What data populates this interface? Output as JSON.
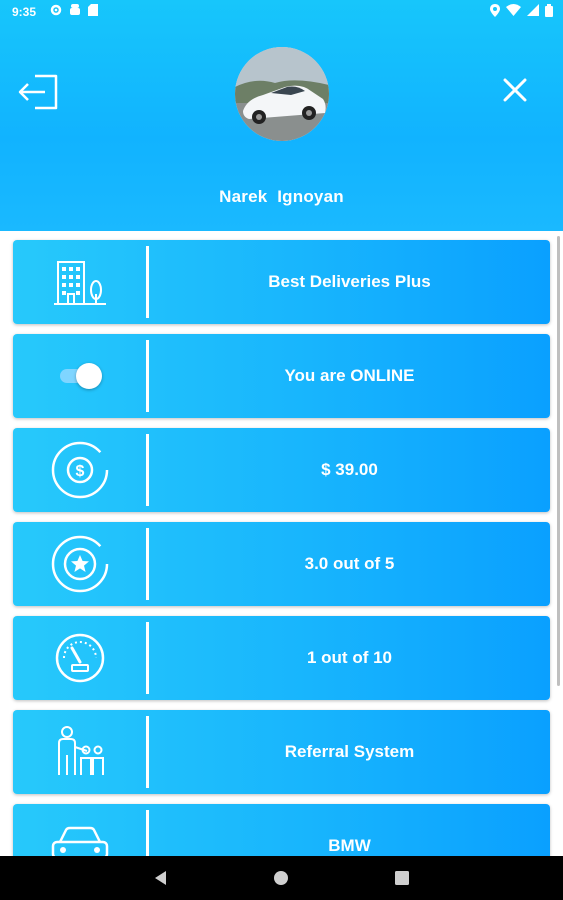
{
  "status_bar": {
    "time": "9:35",
    "left_icons": [
      "settings-icon",
      "android-debug-icon",
      "sd-card-icon"
    ],
    "right_icons": [
      "location-icon",
      "wifi-icon",
      "signal-icon",
      "battery-icon"
    ]
  },
  "header": {
    "user_name": "Narek  Ignoyan",
    "avatar": "car-photo"
  },
  "menu": {
    "items": [
      {
        "label": "Best Deliveries Plus",
        "icon": "building-icon"
      },
      {
        "label": "You are ONLINE",
        "icon": "toggle-icon",
        "toggle_on": true
      },
      {
        "label": "$ 39.00",
        "icon": "dollar-icon"
      },
      {
        "label": "3.0 out of 5",
        "icon": "star-icon"
      },
      {
        "label": "1 out of 10",
        "icon": "speedometer-icon"
      },
      {
        "label": "Referral System",
        "icon": "referral-icon"
      },
      {
        "label": "BMW",
        "icon": "car-icon"
      }
    ]
  },
  "colors": {
    "header_blue": "#17c6fb",
    "card_blue": "#18b5fd"
  },
  "nav": [
    "back-icon",
    "home-icon",
    "recents-icon"
  ]
}
